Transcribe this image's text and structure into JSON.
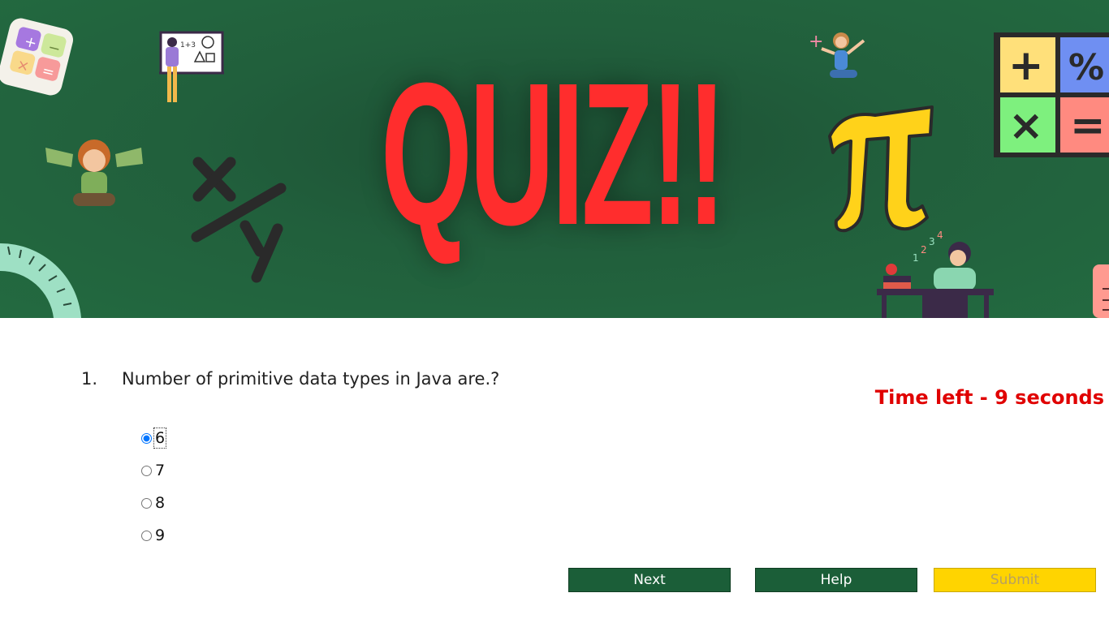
{
  "banner": {
    "title": "QUIZ!!",
    "background_color": "#236a40",
    "title_color": "#ff2d2d",
    "decorations": [
      "math-tiles-icon",
      "teacher-whiteboard-illustration",
      "boy-with-money-illustration",
      "x-over-y-symbol",
      "protractor-icon",
      "girl-with-plus-illustration",
      "pi-symbol",
      "operator-grid-icon",
      "student-at-desk-illustration",
      "ruler-icon"
    ]
  },
  "question": {
    "number": "1.",
    "text": "Number of primitive data types in Java are.?"
  },
  "timer": {
    "text": "Time left - 9 seconds",
    "color": "#e00000"
  },
  "options": [
    {
      "label": "6",
      "selected": true
    },
    {
      "label": "7",
      "selected": false
    },
    {
      "label": "8",
      "selected": false
    },
    {
      "label": "9",
      "selected": false
    }
  ],
  "buttons": {
    "next_label": "Next",
    "help_label": "Help",
    "submit_label": "Submit",
    "primary_color": "#1b5e38",
    "submit_color": "#ffd400"
  }
}
